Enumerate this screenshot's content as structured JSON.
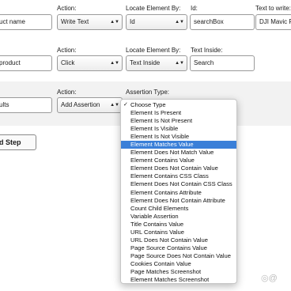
{
  "row1": {
    "labels": {
      "action": "Action:",
      "locate": "Locate Element By:",
      "id": "Id:",
      "text_to_write": "Text to write:"
    },
    "name_value": "uct name",
    "action_value": "Write Text",
    "locate_value": "Id",
    "id_value": "searchBox",
    "text_value": "DJI Mavic Pro"
  },
  "row2": {
    "labels": {
      "action": "Action:",
      "locate": "Locate Element By:",
      "text_inside": "Text Inside:"
    },
    "name_value": "product",
    "action_value": "Click",
    "locate_value": "Text Inside",
    "text_inside_value": "Search"
  },
  "row3": {
    "labels": {
      "action": "Action:",
      "assertion_type": "Assertion Type:"
    },
    "name_value": "ults",
    "action_value": "Add Assertion"
  },
  "add_step_label": "d Step",
  "assertion_dropdown": {
    "selected": "Choose Type",
    "highlighted": "Element Matches Value",
    "options": [
      "Choose Type",
      "Element Is Present",
      "Element Is Not Present",
      "Element Is Visible",
      "Element Is Not Visible",
      "Element Matches Value",
      "Element Does Not Match Value",
      "Element Contains Value",
      "Element Does Not Contain Value",
      "Element Contains CSS Class",
      "Element Does Not Contain CSS Class",
      "Element Contains Attribute",
      "Element Does Not Contain Attribute",
      "Count Child Elements",
      "Variable Assertion",
      "Title Contains Value",
      "URL Contains Value",
      "URL Does Not Contain Value",
      "Page Source Contains Value",
      "Page Source Does Not Contain Value",
      "Cookies Contain Value",
      "Page Matches Screenshot",
      "Element Matches Screenshot"
    ]
  },
  "colors": {
    "highlight": "#3a7fd8",
    "alt_band": "#f2f2f2"
  }
}
